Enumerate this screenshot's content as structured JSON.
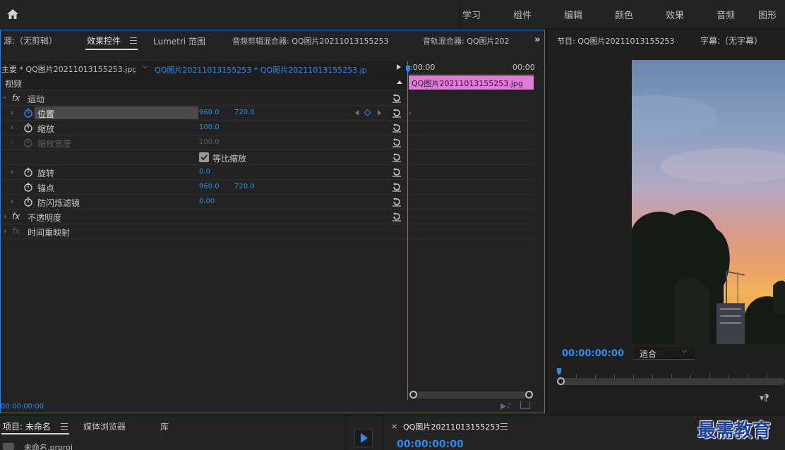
{
  "workspaces": [
    "学习",
    "组件",
    "编辑",
    "颜色",
    "效果",
    "音频",
    "图形"
  ],
  "effect_panel": {
    "tabs": {
      "source": "源:（无剪辑）",
      "effect_controls": "效果控件",
      "lumetri": "Lumetri 范围",
      "audio_clip_mixer": "音频剪辑混合器: QQ图片20211013155253",
      "audio_track_mixer": "音轨混合器: QQ图片202"
    },
    "master_label": "主要 * QQ图片20211013155253.jpg",
    "sequence_clip": "QQ图片20211013155253 * QQ图片20211013155253.jpg",
    "section_video": "视频",
    "motion": "运动",
    "position": {
      "label": "位置",
      "x": "960.0",
      "y": "720.0"
    },
    "scale": {
      "label": "缩放",
      "value": "100.0"
    },
    "scale_width": {
      "label": "缩放宽度",
      "value": "100.0"
    },
    "uniform_scale": "等比缩放",
    "rotation": {
      "label": "旋转",
      "value": "0.0"
    },
    "anchor": {
      "label": "锚点",
      "x": "960.0",
      "y": "720.0"
    },
    "anti_flicker": {
      "label": "防闪烁滤镜",
      "value": "0.00"
    },
    "opacity": "不透明度",
    "time_remap": "时间重映射",
    "fx": "fx",
    "timeline": {
      "start": ":00:00",
      "end": "00:00",
      "clip_name": "QQ图片20211013155253.jpg",
      "clip_color": "#e27ad9"
    },
    "timecode": "00:00:00:00"
  },
  "program_panel": {
    "title": "节目: QQ图片20211013155253",
    "captions": "字幕:（无字幕）",
    "timecode": "00:00:00:00",
    "fit": "适合"
  },
  "bottom": {
    "project_tab": "项目: 未命名",
    "media_browser": "媒体浏览器",
    "library": "库",
    "project_file": "未命名.prproj",
    "sequence_tab": "QQ图片20211013155253",
    "seq_timecode": "00:00:00:00",
    "watermark": "最需教育"
  },
  "colors": {
    "accent": "#2d8ceb",
    "panel": "#232323",
    "clip": "#e27ad9"
  }
}
